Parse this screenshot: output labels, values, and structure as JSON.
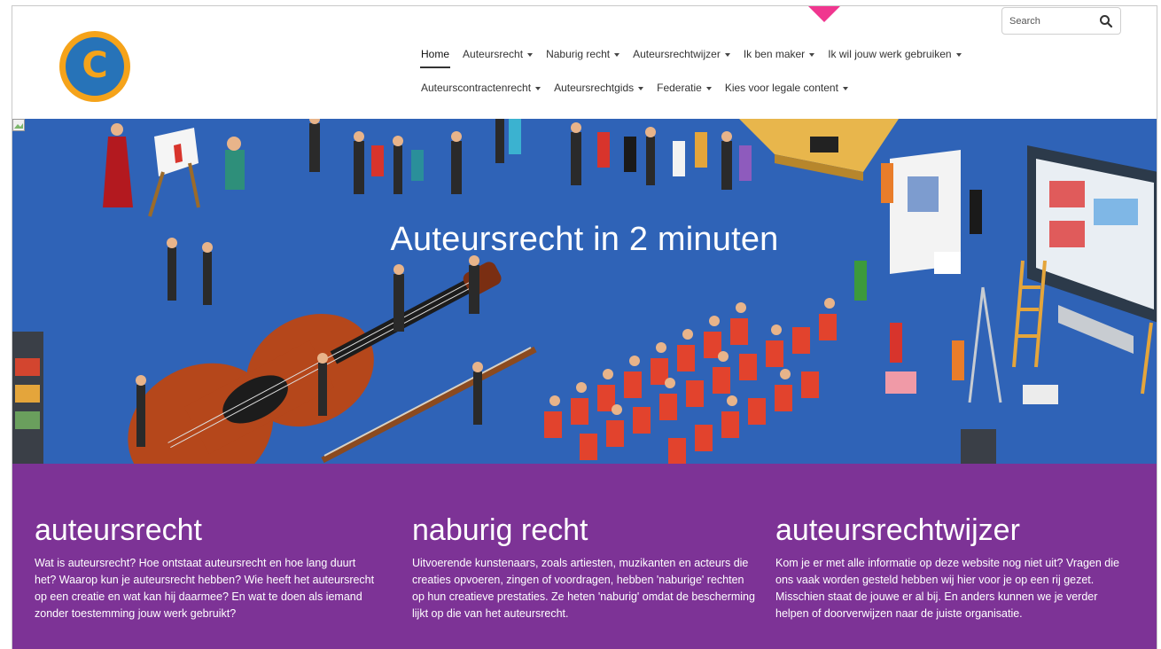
{
  "search": {
    "placeholder": "Search"
  },
  "logo": {
    "letter": "C"
  },
  "nav": {
    "row1": [
      {
        "label": "Home",
        "active": true,
        "dropdown": false
      },
      {
        "label": "Auteursrecht",
        "dropdown": true
      },
      {
        "label": "Naburig recht",
        "dropdown": true
      },
      {
        "label": "Auteursrechtwijzer",
        "dropdown": true
      },
      {
        "label": "Ik ben maker",
        "dropdown": true
      },
      {
        "label": "Ik wil jouw werk gebruiken",
        "dropdown": true
      }
    ],
    "row2": [
      {
        "label": "Auteurscontractenrecht",
        "dropdown": true
      },
      {
        "label": "Auteursrechtgids",
        "dropdown": true
      },
      {
        "label": "Federatie",
        "dropdown": true
      },
      {
        "label": "Kies voor legale content",
        "dropdown": true
      }
    ]
  },
  "hero": {
    "title": "Auteursrecht in 2 minuten"
  },
  "sections": [
    {
      "title": "auteursrecht",
      "text": "Wat is auteursrecht? Hoe ontstaat auteursrecht en hoe lang duurt het? Waarop kun je auteursrecht hebben? Wie heeft het auteursrecht op een creatie en wat kan hij daarmee? En wat te doen als iemand zonder toestemming jouw werk gebruikt?"
    },
    {
      "title": "naburig recht",
      "text": "Uitvoerende kunstenaars, zoals artiesten, muzikanten en acteurs die creaties opvoeren, zingen of voordragen, hebben 'naburige' rechten op hun creatieve prestaties. Ze heten 'naburig' omdat de bescherming lijkt op die van het auteursrecht."
    },
    {
      "title": "auteursrechtwijzer",
      "text": "Kom je er met alle informatie op deze website nog niet uit? Vragen die ons vaak worden gesteld hebben wij hier voor je op een rij gezet. Misschien staat de jouwe er al bij. En anders kunnen we je verder helpen of doorverwijzen naar de juiste organisatie."
    }
  ],
  "colors": {
    "hero_bg": "#2f63b7",
    "purple": "#7d3396",
    "marker": "#f0368f",
    "logo_ring": "#f5a31a",
    "logo_fill": "#2773b8"
  }
}
